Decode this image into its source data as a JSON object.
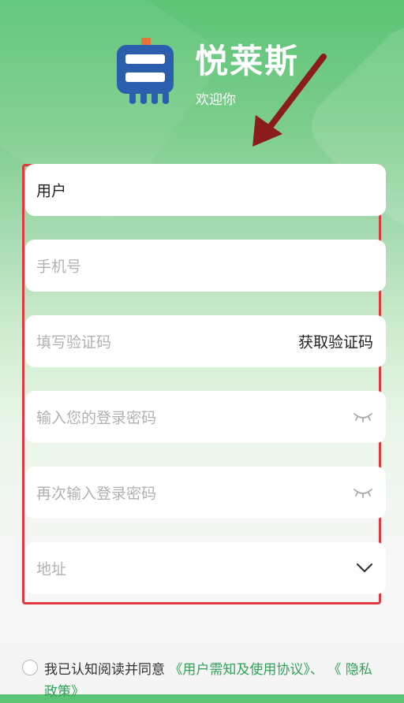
{
  "header": {
    "app_name": "悦莱斯",
    "welcome": "欢迎你"
  },
  "form": {
    "username": "用户",
    "phone_placeholder": "手机号",
    "code_placeholder": "填写验证码",
    "get_code": "获取验证码",
    "password_placeholder": "输入您的登录密码",
    "password_confirm_placeholder": "再次输入登录密码",
    "address_placeholder": "地址"
  },
  "agreement": {
    "prefix": "我已认知阅读并同意",
    "user_agreement": "《用户需知及使用协议》",
    "separator": "、",
    "privacy": "《 隐私政策》"
  },
  "colors": {
    "brand_green": "#5cc476",
    "link_green": "#2fa356",
    "highlight_red": "#e0393e",
    "arrow_red": "#8b1c1c",
    "logo_blue": "#2b5fad",
    "logo_orange": "#e8743b"
  }
}
